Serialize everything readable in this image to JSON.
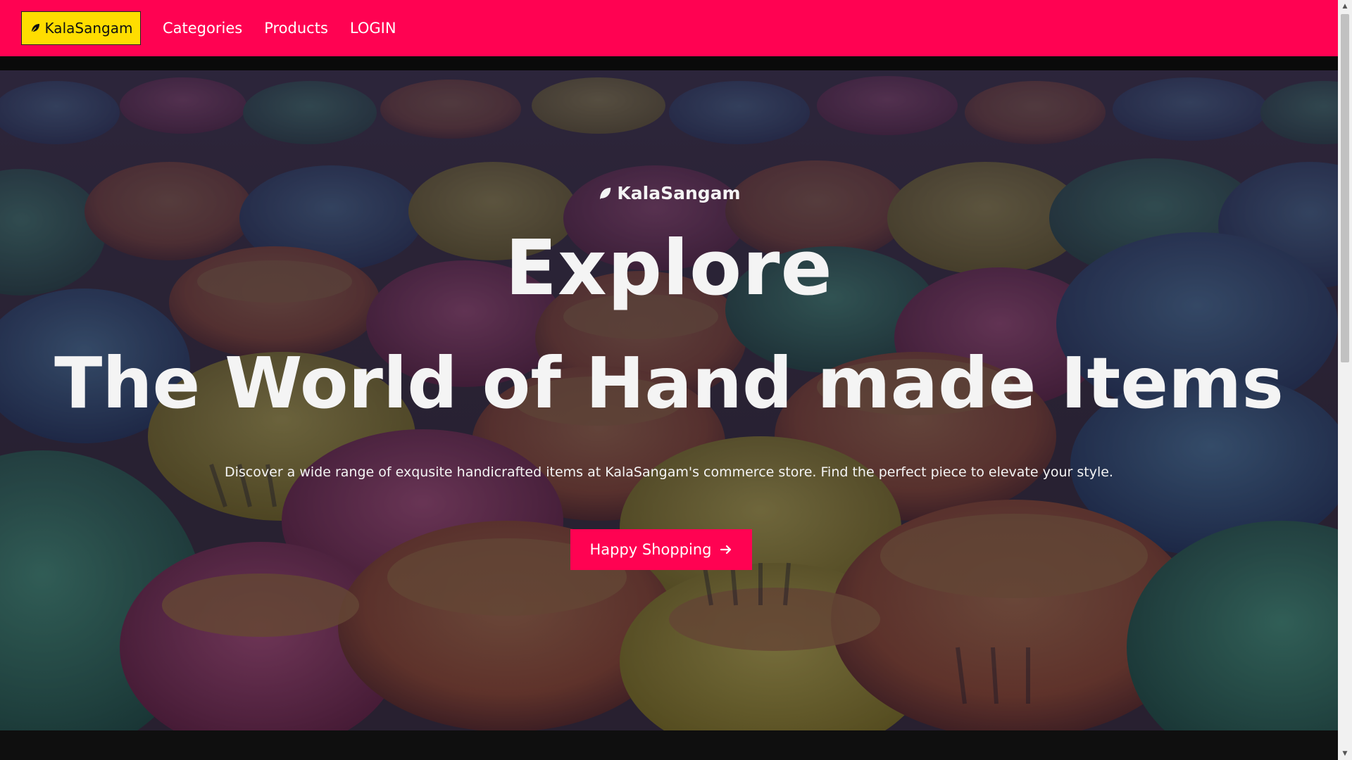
{
  "navbar": {
    "brand_label": "KalaSangam",
    "links": [
      "Categories",
      "Products",
      "LOGIN"
    ],
    "background_color": "#ff0252",
    "brand_color": "#ffdd00"
  },
  "hero": {
    "brand_label": "KalaSangam",
    "headline_1": "Explore",
    "headline_2": "The World of Hand made Items",
    "description": "Discover a wide range of exqusite handicrafted items at KalaSangam's commerce store. Find the perfect piece to elevate your style.",
    "cta_label": "Happy Shopping",
    "cta_icon": "arrow-right-icon",
    "background_image": "colorful painted clay pots"
  }
}
